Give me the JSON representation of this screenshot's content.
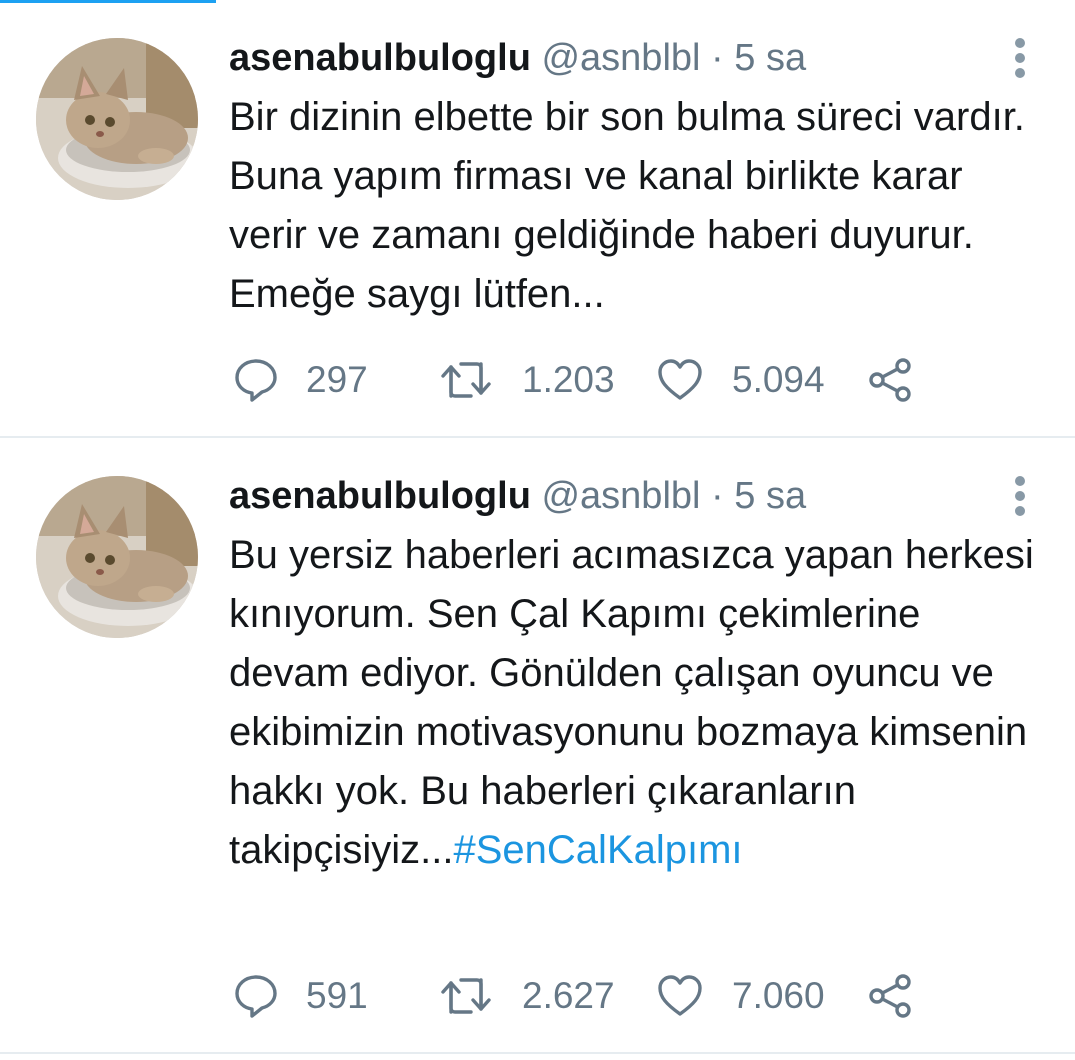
{
  "tweets": [
    {
      "display_name": "asenabulbuloglu",
      "handle": "@asnblbl",
      "separator": "·",
      "time": "5 sa",
      "text_main": "Bir dizinin elbette bir son bulma süreci vardır. Buna yapım firması ve kanal birlikte karar verir ve zamanı geldiğinde haberi duyurur. Emeğe saygı lütfen...",
      "hashtag": "",
      "replies": "297",
      "retweets": "1.203",
      "likes": "5.094"
    },
    {
      "display_name": "asenabulbuloglu",
      "handle": "@asnblbl",
      "separator": "·",
      "time": "5 sa",
      "text_main": "Bu yersiz haberleri acımasızca yapan herkesi kınıyorum. Sen Çal Kapımı çekimlerine devam ediyor. Gönülden çalışan oyuncu ve ekibimizin motivasyonunu bozmaya kimsenin hakkı yok. Bu haberleri çıkaranların takipçisiyiz...",
      "hashtag": "#SenCalKalpımı",
      "replies": "591",
      "retweets": "2.627",
      "likes": "7.060"
    }
  ],
  "icons": {
    "reply": "reply-icon",
    "retweet": "retweet-icon",
    "like": "heart-icon",
    "share": "share-icon",
    "more": "more-vertical-icon",
    "avatar": "cat-avatar"
  },
  "colors": {
    "text": "#14171a",
    "secondary": "#657786",
    "link": "#1b95e0",
    "divider": "#e6ecf0",
    "accent": "#1da1f2"
  }
}
